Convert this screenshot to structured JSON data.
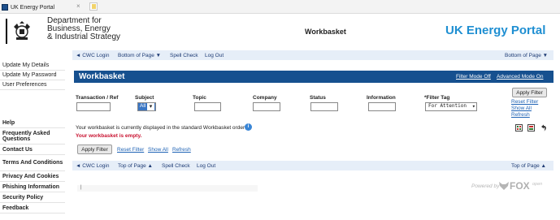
{
  "browser_tab": {
    "title": "UK Energy Portal",
    "close": "×"
  },
  "header": {
    "dept_line1": "Department for",
    "dept_line2": "Business, Energy",
    "dept_line3": "& Industrial Strategy",
    "page": "Workbasket",
    "brand": "UK Energy Portal"
  },
  "sidebar": {
    "top_items": [
      "Update My Details",
      "Update My Password",
      "User Preferences"
    ],
    "help_items": [
      "Help",
      "Frequently Asked Questions",
      "Contact Us",
      "Terms And Conditions",
      "Privacy And Cookies",
      "Phishing Information",
      "Security Policy",
      "Feedback"
    ]
  },
  "top_links": {
    "cwc_login": "◄ CWC Login",
    "bottom_of_page": "Bottom of Page ▼",
    "spell_check": "Spell Check",
    "log_out": "Log Out",
    "bottom_of_page_right": "Bottom of Page ▼"
  },
  "panel": {
    "title": "Workbasket",
    "filter_mode_off": "Filter Mode Off",
    "advanced_mode_on": "Advanced Mode On"
  },
  "filters": {
    "transaction_ref": "Transaction / Ref",
    "subject": "Subject",
    "subject_value": "All",
    "topic": "Topic",
    "company": "Company",
    "status": "Status",
    "information": "Information",
    "filter_tag": "*Filter Tag",
    "filter_tag_value": "For Attention"
  },
  "actions": {
    "apply_filter": "Apply Filter",
    "reset_filter": "Reset Filter",
    "show_all": "Show All",
    "refresh": "Refresh"
  },
  "messages": {
    "info": "Your workbasket is currently displayed in the standard Workbasket order",
    "empty": "Your workbasket is empty."
  },
  "bottom_links": {
    "cwc_login": "◄ CWC Login",
    "top_of_page": "Top of Page ▲",
    "spell_check": "Spell Check",
    "log_out": "Log Out",
    "top_of_page_right": "Top of Page ▲"
  },
  "footer": {
    "url_caret": "|",
    "powered_by": "Powered by",
    "fox": "FOX",
    "fox_sub": "open"
  },
  "colors": {
    "brand_blue": "#1f8fd2",
    "panel_blue": "#16508f",
    "link_blue": "#1f63b5",
    "error_red": "#c8102e"
  }
}
